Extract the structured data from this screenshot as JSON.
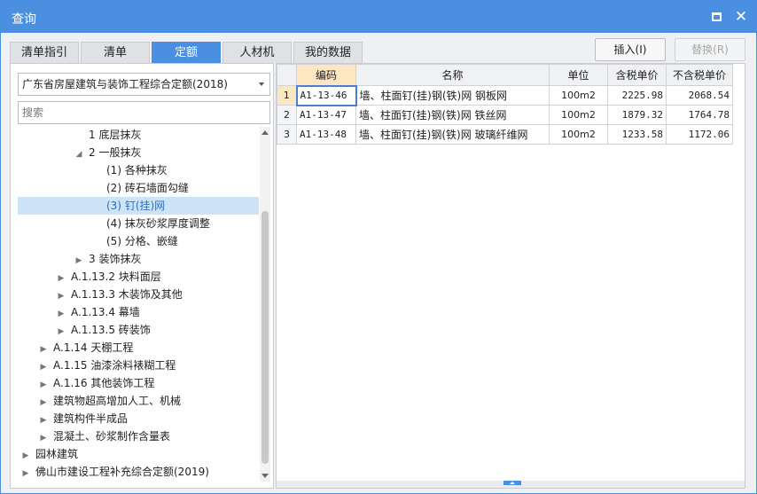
{
  "window": {
    "title": "查询"
  },
  "tabs": [
    {
      "label": "清单指引",
      "active": false
    },
    {
      "label": "清单",
      "active": false
    },
    {
      "label": "定额",
      "active": true
    },
    {
      "label": "人材机",
      "active": false
    },
    {
      "label": "我的数据",
      "active": false
    }
  ],
  "actions": {
    "insert_label": "插入(I)",
    "replace_label": "替换(R)"
  },
  "library_select": {
    "value": "广东省房屋建筑与装饰工程综合定额(2018)"
  },
  "search": {
    "placeholder": "搜索"
  },
  "tree": [
    {
      "label": "1 底层抹灰",
      "level": 3,
      "toggle": "none",
      "selected": false
    },
    {
      "label": "2 一般抹灰",
      "level": 3,
      "toggle": "expanded",
      "selected": false
    },
    {
      "label": "(1) 各种抹灰",
      "level": 4,
      "toggle": "none",
      "selected": false
    },
    {
      "label": "(2) 砖石墙面勾缝",
      "level": 4,
      "toggle": "none",
      "selected": false
    },
    {
      "label": "(3) 钉(挂)网",
      "level": 4,
      "toggle": "none",
      "selected": true
    },
    {
      "label": "(4) 抹灰砂浆厚度调整",
      "level": 4,
      "toggle": "none",
      "selected": false
    },
    {
      "label": "(5) 分格、嵌缝",
      "level": 4,
      "toggle": "none",
      "selected": false
    },
    {
      "label": "3 装饰抹灰",
      "level": 3,
      "toggle": "collapsed",
      "selected": false
    },
    {
      "label": "A.1.13.2 块料面层",
      "level": 2,
      "toggle": "collapsed",
      "selected": false
    },
    {
      "label": "A.1.13.3 木装饰及其他",
      "level": 2,
      "toggle": "collapsed",
      "selected": false
    },
    {
      "label": "A.1.13.4 幕墙",
      "level": 2,
      "toggle": "collapsed",
      "selected": false
    },
    {
      "label": "A.1.13.5 砖装饰",
      "level": 2,
      "toggle": "collapsed",
      "selected": false
    },
    {
      "label": "A.1.14 天棚工程",
      "level": 1,
      "toggle": "collapsed",
      "selected": false
    },
    {
      "label": "A.1.15 油漆涂料裱糊工程",
      "level": 1,
      "toggle": "collapsed",
      "selected": false
    },
    {
      "label": "A.1.16 其他装饰工程",
      "level": 1,
      "toggle": "collapsed",
      "selected": false
    },
    {
      "label": "建筑物超高增加人工、机械",
      "level": 1,
      "toggle": "collapsed",
      "selected": false
    },
    {
      "label": "建筑构件半成品",
      "level": 1,
      "toggle": "collapsed",
      "selected": false
    },
    {
      "label": "混凝土、砂浆制作含量表",
      "level": 1,
      "toggle": "collapsed",
      "selected": false
    },
    {
      "label": "园林建筑",
      "level": 0,
      "toggle": "collapsed",
      "selected": false
    },
    {
      "label": "佛山市建设工程补充综合定额(2019)",
      "level": 0,
      "toggle": "collapsed",
      "selected": false
    }
  ],
  "grid": {
    "headers": {
      "code": "编码",
      "name": "名称",
      "unit": "单位",
      "price_tax": "含税单价",
      "price_notax": "不含税单价"
    },
    "rows": [
      {
        "idx": "1",
        "code": "A1-13-46",
        "name": "墙、柱面钉(挂)钢(铁)网 钢板网",
        "unit": "100m2",
        "price_tax": "2225.98",
        "price_notax": "2068.54"
      },
      {
        "idx": "2",
        "code": "A1-13-47",
        "name": "墙、柱面钉(挂)钢(铁)网 铁丝网",
        "unit": "100m2",
        "price_tax": "1879.32",
        "price_notax": "1764.78"
      },
      {
        "idx": "3",
        "code": "A1-13-48",
        "name": "墙、柱面钉(挂)钢(铁)网 玻璃纤维网",
        "unit": "100m2",
        "price_tax": "1233.58",
        "price_notax": "1172.06"
      }
    ]
  }
}
